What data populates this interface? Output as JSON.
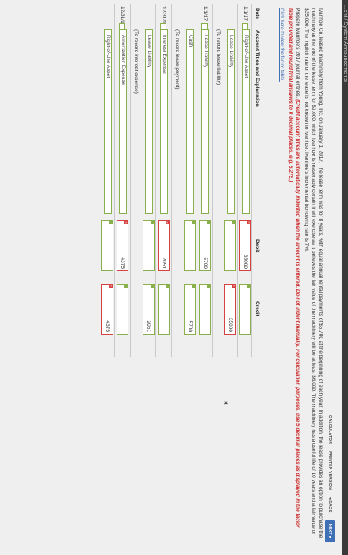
{
  "topbar": {
    "label": "...ent / System Announcements"
  },
  "nav": {
    "calculator": "CALCULATOR",
    "print": "PRINTER VERSION",
    "back": "◂ BACK",
    "next": "NEXT ▸"
  },
  "problem": {
    "p1": "Ivanhoe Co. leased machinery from Young, Inc. on January 1, 2017. The lease term was for 8 years, with equal annual rental payments of $5,700 at the beginning of each year. In addition, the lease provides an option to purchase the machinery at the end of the lease term for $3,000, which Ivanhoe is reasonably certain it will exercise as it believes the fair value of the machinery will be at least $6,000. The machinery has a useful life of 10 years and a fair value of $35,000. The implicit rate of the lease is not known to Ivanhoe. Ivanhoe's incremental borrowing rate is 7%.",
    "p2": "Prepare Ivanhoe's 2017 journal entries.",
    "note": "(Credit account titles are automatically indented when the amount is entered. Do not indent manually. For calculation purposes, use 5 decimal places as displayed in the factor table provided and round final answers to 0 decimal places, e.g. 5,275.)",
    "link": "Click here to view the factor table."
  },
  "table": {
    "headers": {
      "date": "Date",
      "account": "Account Titles and Explanation",
      "debit": "Debit",
      "credit": "Credit"
    },
    "rows": [
      {
        "date": "1/1/17",
        "account": "Right-of-Use Asset",
        "debit": "35000",
        "credit": ""
      },
      {
        "date": "",
        "account": "Lease Liability",
        "debit": "",
        "credit": "35000"
      },
      {
        "date": "",
        "account": "(To record lease liability)",
        "debit": "",
        "credit": ""
      },
      {
        "date": "1/1/17",
        "account": "Lease Liability",
        "debit": "5700",
        "credit": ""
      },
      {
        "date": "",
        "account": "Cash",
        "debit": "",
        "credit": "5700"
      },
      {
        "date": "",
        "account": "(To record lease payment)",
        "debit": "",
        "credit": ""
      },
      {
        "date": "12/31/17",
        "account": "Interest Expense",
        "debit": "2051",
        "credit": ""
      },
      {
        "date": "",
        "account": "Lease Liability",
        "debit": "",
        "credit": "2051"
      },
      {
        "date": "",
        "account": "(To record interest expense)",
        "debit": "",
        "credit": ""
      },
      {
        "date": "12/31/17",
        "account": "Amortization Expense",
        "debit": "4375",
        "credit": ""
      },
      {
        "date": "",
        "account": "Right-of-Use Asset",
        "debit": "",
        "credit": "4375"
      }
    ]
  },
  "colors": {
    "valid": "#8ab04b",
    "invalid": "#d64141",
    "accent": "#3f6fb5"
  }
}
